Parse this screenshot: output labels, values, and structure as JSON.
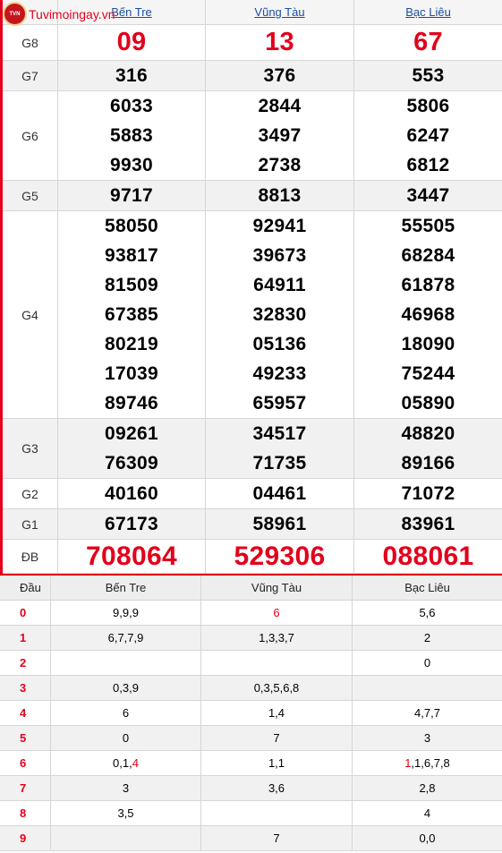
{
  "logo": {
    "text": "Tuvimoingay.vn",
    "seal_text": "TVN"
  },
  "provinces": [
    "Bến Tre",
    "Vũng Tàu",
    "Bạc Liêu"
  ],
  "prizes": [
    {
      "label": "G8",
      "values": [
        [
          "09"
        ],
        [
          "13"
        ],
        [
          "67"
        ]
      ]
    },
    {
      "label": "G7",
      "values": [
        [
          "316"
        ],
        [
          "376"
        ],
        [
          "553"
        ]
      ]
    },
    {
      "label": "G6",
      "values": [
        [
          "6033",
          "5883",
          "9930"
        ],
        [
          "2844",
          "3497",
          "2738"
        ],
        [
          "5806",
          "6247",
          "6812"
        ]
      ]
    },
    {
      "label": "G5",
      "values": [
        [
          "9717"
        ],
        [
          "8813"
        ],
        [
          "3447"
        ]
      ]
    },
    {
      "label": "G4",
      "values": [
        [
          "58050",
          "93817",
          "81509",
          "67385",
          "80219",
          "17039",
          "89746"
        ],
        [
          "92941",
          "39673",
          "64911",
          "32830",
          "05136",
          "49233",
          "65957"
        ],
        [
          "55505",
          "68284",
          "61878",
          "46968",
          "18090",
          "75244",
          "05890"
        ]
      ]
    },
    {
      "label": "G3",
      "values": [
        [
          "09261",
          "76309"
        ],
        [
          "34517",
          "71735"
        ],
        [
          "48820",
          "89166"
        ]
      ]
    },
    {
      "label": "G2",
      "values": [
        [
          "40160"
        ],
        [
          "04461"
        ],
        [
          "71072"
        ]
      ]
    },
    {
      "label": "G1",
      "values": [
        [
          "67173"
        ],
        [
          "58961"
        ],
        [
          "83961"
        ]
      ]
    },
    {
      "label": "ĐB",
      "values": [
        [
          "708064"
        ],
        [
          "529306"
        ],
        [
          "088061"
        ]
      ]
    }
  ],
  "loto": {
    "header": [
      "Đầu",
      "Bến Tre",
      "Vũng Tàu",
      "Bạc Liêu"
    ],
    "rows": [
      {
        "dau": "0",
        "cells": [
          [
            {
              "t": "9,9,9"
            }
          ],
          [
            {
              "t": "6",
              "red": true
            }
          ],
          [
            {
              "t": "5,6"
            }
          ]
        ]
      },
      {
        "dau": "1",
        "cells": [
          [
            {
              "t": "6,7,7,9"
            }
          ],
          [
            {
              "t": "1,3,3,7"
            }
          ],
          [
            {
              "t": "2"
            }
          ]
        ]
      },
      {
        "dau": "2",
        "cells": [
          [
            {
              "t": ""
            }
          ],
          [
            {
              "t": ""
            }
          ],
          [
            {
              "t": "0"
            }
          ]
        ]
      },
      {
        "dau": "3",
        "cells": [
          [
            {
              "t": "0,3,9"
            }
          ],
          [
            {
              "t": "0,3,5,6,8"
            }
          ],
          [
            {
              "t": ""
            }
          ]
        ]
      },
      {
        "dau": "4",
        "cells": [
          [
            {
              "t": "6"
            }
          ],
          [
            {
              "t": "1,4"
            }
          ],
          [
            {
              "t": "4,7,7"
            }
          ]
        ]
      },
      {
        "dau": "5",
        "cells": [
          [
            {
              "t": "0"
            }
          ],
          [
            {
              "t": "7"
            }
          ],
          [
            {
              "t": "3"
            }
          ]
        ]
      },
      {
        "dau": "6",
        "cells": [
          [
            {
              "t": "0,1,"
            },
            {
              "t": "4",
              "red": true
            }
          ],
          [
            {
              "t": "1,1"
            }
          ],
          [
            {
              "t": "1",
              "red": true
            },
            {
              "t": ",1,6,7,8"
            }
          ]
        ]
      },
      {
        "dau": "7",
        "cells": [
          [
            {
              "t": "3"
            }
          ],
          [
            {
              "t": "3,6"
            }
          ],
          [
            {
              "t": "2,8"
            }
          ]
        ]
      },
      {
        "dau": "8",
        "cells": [
          [
            {
              "t": "3,5"
            }
          ],
          [
            {
              "t": ""
            }
          ],
          [
            {
              "t": "4"
            }
          ]
        ]
      },
      {
        "dau": "9",
        "cells": [
          [
            {
              "t": ""
            }
          ],
          [
            {
              "t": "7"
            }
          ],
          [
            {
              "t": "0,0"
            }
          ]
        ]
      }
    ]
  },
  "colors": {
    "accent": "#e3001b",
    "link": "#1a4ea0",
    "shade": "#f1f1f1",
    "border": "#d6d6d6"
  }
}
